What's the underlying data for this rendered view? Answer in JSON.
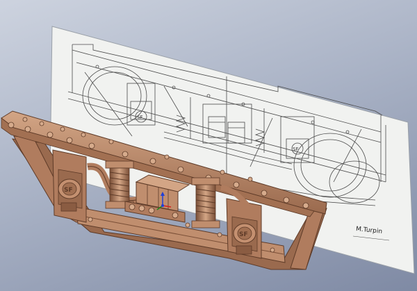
{
  "viewport": {
    "background_top": "#cdd3df",
    "background_bottom": "#7f8aa4"
  },
  "drawing": {
    "signature": "M.Turpin",
    "sheet_color": "#f1f2f0",
    "line_color": "#4a4a4a"
  },
  "model": {
    "part_color": "#b07c5e",
    "part_highlight": "#d3a585",
    "part_shadow": "#7a4f37",
    "badge_label": "SF"
  },
  "triad": {
    "x_color": "#d42020",
    "y_color": "#1f8a1f",
    "z_color": "#2040d8",
    "icon": "coordinate-triad-icon"
  }
}
